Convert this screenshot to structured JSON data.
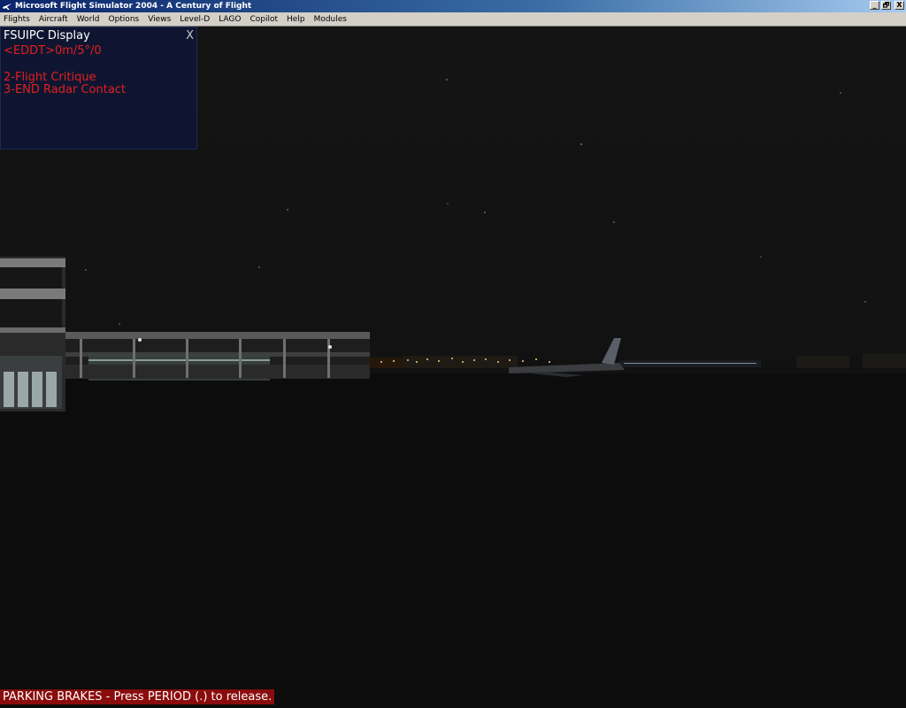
{
  "window": {
    "title": "Microsoft Flight Simulator 2004 - A Century of Flight",
    "buttons": [
      "_",
      "🗗",
      "X"
    ]
  },
  "menu": {
    "items": [
      "Flights",
      "Aircraft",
      "World",
      "Options",
      "Views",
      "Level-D",
      "LAGO",
      "Copilot",
      "Help",
      "Modules"
    ]
  },
  "fsuipc": {
    "title": "FSUIPC Display",
    "close": "X",
    "lines": [
      "<EDDT>0m/5°/0",
      "2-Flight Critique",
      "3-END Radar Contact"
    ]
  },
  "status": {
    "message": "PARKING BRAKES - Press PERIOD (.) to release."
  },
  "colors": {
    "title_start": "#0a246a",
    "title_end": "#a6caf0",
    "menu_bg": "#d4d0c8",
    "panel_bg": "#0f1530",
    "panel_text": "#e02020",
    "status_bg": "#8a0c0c"
  }
}
